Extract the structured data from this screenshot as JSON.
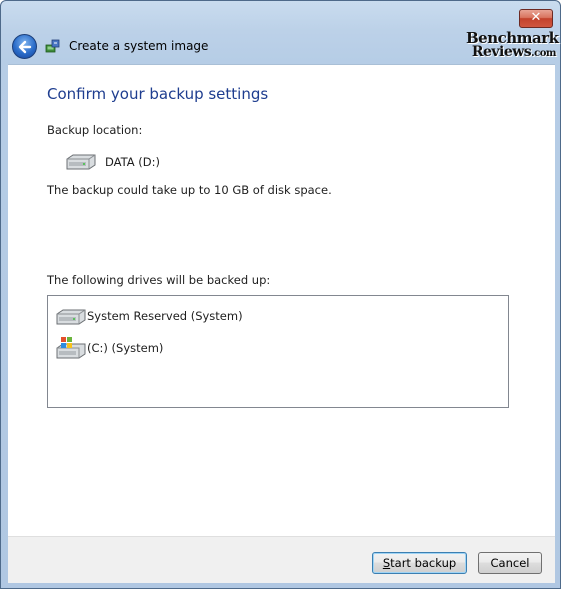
{
  "window": {
    "title": "Create a system image",
    "close_label": "✕"
  },
  "watermark": {
    "line1": "Benchmark",
    "line2": "Reviews",
    "line2_suffix": ".com"
  },
  "main": {
    "heading": "Confirm your backup settings",
    "backup_location_label": "Backup location:",
    "backup_location_drive": "DATA (D:)",
    "space_notice": "The backup could take up to 10 GB of disk space.",
    "drives_label": "The following drives will be backed up:",
    "drives": [
      {
        "label": "System Reserved (System)",
        "icon": "hard-drive-icon"
      },
      {
        "label": "(C:) (System)",
        "icon": "windows-drive-icon"
      }
    ]
  },
  "footer": {
    "start_label": "Start backup",
    "start_accesskey_prefix": "S",
    "start_rest": "tart backup",
    "cancel_label": "Cancel"
  },
  "colors": {
    "heading": "#1e3d8f",
    "chrome": "#b6cde6",
    "close": "#c3422c"
  }
}
